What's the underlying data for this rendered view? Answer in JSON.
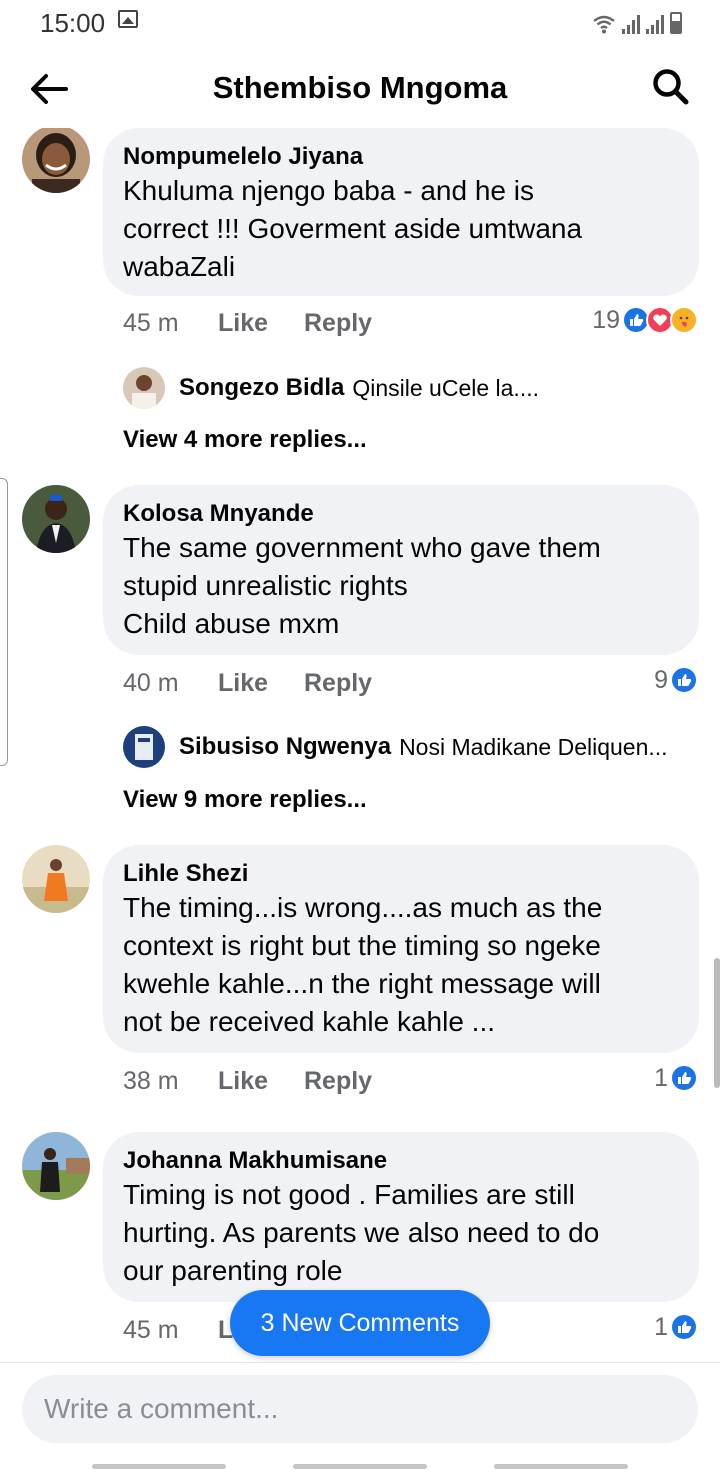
{
  "status_bar": {
    "time": "15:00"
  },
  "header": {
    "title": "Sthembiso Mngoma"
  },
  "comments": [
    {
      "author": "Nompumelelo Jiyana",
      "text": "Khuluma njengo baba - and he is\ncorrect !!! Goverment aside umtwana\nwabaZali",
      "time": "45 m",
      "like_label": "Like",
      "reply_label": "Reply",
      "reaction_count": "19",
      "reactions": [
        "like-icon",
        "love-icon",
        "care-icon"
      ],
      "reply_preview": {
        "author": "Songezo Bidla",
        "text": "Qinsile uCele la...."
      },
      "view_more": "View 4 more replies..."
    },
    {
      "author": "Kolosa Mnyande",
      "text": "The same government who gave them\nstupid unrealistic rights\nChild abuse mxm",
      "time": "40 m",
      "like_label": "Like",
      "reply_label": "Reply",
      "reaction_count": "9",
      "reactions": [
        "like-icon"
      ],
      "reply_preview": {
        "author": "Sibusiso Ngwenya",
        "text": "Nosi Madikane Deliquen..."
      },
      "view_more": "View 9 more replies..."
    },
    {
      "author": "Lihle Shezi",
      "text": "The timing...is wrong....as much as the\ncontext is right but the timing so ngeke\nkwehle kahle...n the right message will\nnot be received kahle kahle ...",
      "time": "38 m",
      "like_label": "Like",
      "reply_label": "Reply",
      "reaction_count": "1",
      "reactions": [
        "like-icon"
      ]
    },
    {
      "author": "Johanna Makhumisane",
      "text": "Timing is not good . Families  are still\nhurting.  As parents  we also need to do\nour parenting role",
      "time": "45 m",
      "like_label": "L",
      "reaction_count": "1",
      "reactions": [
        "like-icon"
      ]
    }
  ],
  "new_comments_pill": "3 New Comments",
  "composer": {
    "placeholder": "Write a comment..."
  },
  "colors": {
    "accent": "#1877f2",
    "bubble": "#f0f2f5",
    "secondary_text": "#65676b"
  }
}
